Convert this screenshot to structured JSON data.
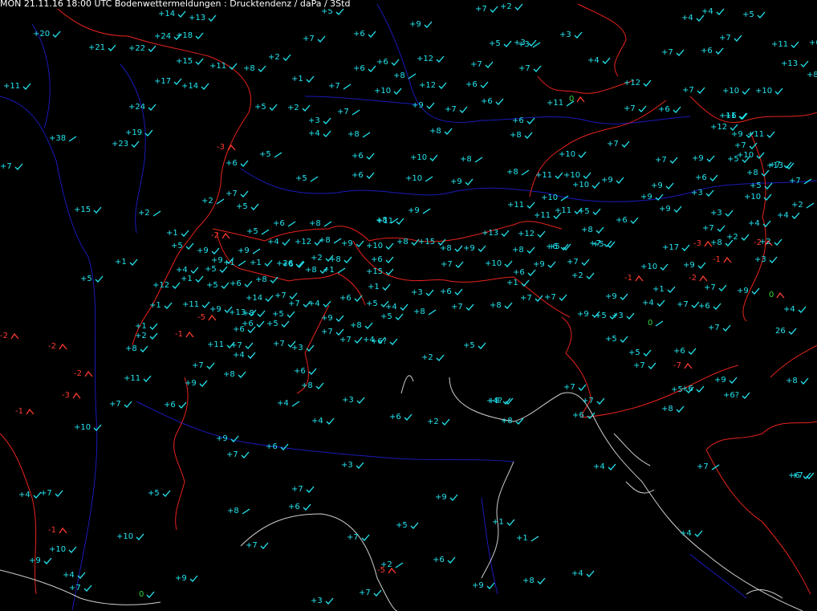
{
  "title": "MON 21.11.16 18:00 UTC  Bodenwettermeldungen :  Drucktendenz / daPa / 3Std",
  "colors": {
    "background": "#000000",
    "rising": "#22e6f0",
    "falling": "#ff3b2f",
    "steady": "#37d43a",
    "border": "#e8231c",
    "river": "#1a1ab8",
    "coast": "#cfcfcf"
  },
  "stations": [
    {
      "v": "+14",
      "s": "check"
    },
    {
      "v": "+13",
      "s": "check"
    },
    {
      "v": "+5",
      "s": "check"
    },
    {
      "v": "+7",
      "s": "check"
    },
    {
      "v": "+2",
      "s": "check"
    },
    {
      "v": "+4",
      "s": "check"
    },
    {
      "v": "+4",
      "s": "check"
    },
    {
      "v": "+5",
      "s": "check"
    },
    {
      "v": "+20",
      "s": "check"
    },
    {
      "v": "+24",
      "s": "check"
    },
    {
      "v": "+18",
      "s": "check"
    },
    {
      "v": "+6",
      "s": "check"
    },
    {
      "v": "+9",
      "s": "check"
    },
    {
      "v": "+7",
      "s": "check"
    },
    {
      "v": "+3",
      "s": "check"
    },
    {
      "v": "+3",
      "s": "check"
    },
    {
      "v": "+7",
      "s": "check"
    },
    {
      "v": "+11",
      "s": "check"
    },
    {
      "v": "+6",
      "s": "check"
    },
    {
      "v": "+21",
      "s": "check"
    },
    {
      "v": "+22",
      "s": "check"
    },
    {
      "v": "+5",
      "s": "check"
    },
    {
      "v": "+3",
      "s": "rise"
    },
    {
      "v": "+7",
      "s": "check"
    },
    {
      "v": "+6",
      "s": "check"
    },
    {
      "v": "+2",
      "s": "check"
    },
    {
      "v": "+15",
      "s": "check"
    },
    {
      "v": "+11",
      "s": "check"
    },
    {
      "v": "+8",
      "s": "check"
    },
    {
      "v": "+6",
      "s": "check"
    },
    {
      "v": "+6",
      "s": "check"
    },
    {
      "v": "+12",
      "s": "check"
    },
    {
      "v": "+7",
      "s": "check"
    },
    {
      "v": "+7",
      "s": "check"
    },
    {
      "v": "+4",
      "s": "check"
    },
    {
      "v": "+13",
      "s": "check"
    },
    {
      "v": "+8",
      "s": "check"
    },
    {
      "v": "+17",
      "s": "check"
    },
    {
      "v": "+14",
      "s": "check"
    },
    {
      "v": "+1",
      "s": "check"
    },
    {
      "v": "+7",
      "s": "rise"
    },
    {
      "v": "+8",
      "s": "rise"
    },
    {
      "v": "+12",
      "s": "check"
    },
    {
      "v": "+6",
      "s": "check"
    },
    {
      "v": "+11",
      "s": "rise"
    },
    {
      "v": "+10",
      "s": "check"
    },
    {
      "v": "+12",
      "s": "check"
    },
    {
      "v": "+7",
      "s": "check"
    },
    {
      "v": "+6",
      "s": "check"
    },
    {
      "v": "+7",
      "s": "check"
    },
    {
      "v": "+10",
      "s": "check"
    },
    {
      "v": "+10",
      "s": "check"
    },
    {
      "v": "+11",
      "s": "check"
    },
    {
      "v": "+24",
      "s": "check"
    },
    {
      "v": "+5",
      "s": "check"
    },
    {
      "v": "+2",
      "s": "check"
    },
    {
      "v": "+7",
      "s": "rise"
    },
    {
      "v": "+9",
      "s": "check"
    },
    {
      "v": "+7",
      "s": "check"
    },
    {
      "v": "+6",
      "s": "check"
    },
    {
      "v": "+11",
      "s": "check"
    },
    {
      "v": "0",
      "s": "fall"
    },
    {
      "v": "+7",
      "s": "check"
    },
    {
      "v": "+6",
      "s": "check"
    },
    {
      "v": "+19",
      "s": "check"
    },
    {
      "v": "+3",
      "s": "check"
    },
    {
      "v": "+4",
      "s": "check"
    },
    {
      "v": "+8",
      "s": "rise"
    },
    {
      "v": "+8",
      "s": "check"
    },
    {
      "v": "+8",
      "s": "check"
    },
    {
      "v": "+6",
      "s": "check"
    },
    {
      "v": "+9",
      "s": "check"
    },
    {
      "v": "+12",
      "s": "check"
    },
    {
      "v": "+11",
      "s": "check"
    },
    {
      "v": "+38",
      "s": "rise"
    },
    {
      "v": "+23",
      "s": "check"
    },
    {
      "v": "-3",
      "s": "fall"
    },
    {
      "v": "+5",
      "s": "rise"
    },
    {
      "v": "+6",
      "s": "check"
    },
    {
      "v": "+10",
      "s": "check"
    },
    {
      "v": "+8",
      "s": "rise"
    },
    {
      "v": "+10",
      "s": "check"
    },
    {
      "v": "+7",
      "s": "check"
    },
    {
      "v": "+9",
      "s": "check"
    },
    {
      "v": "+5",
      "s": "check"
    },
    {
      "v": "+13",
      "s": "check"
    },
    {
      "v": "+7",
      "s": "check"
    },
    {
      "v": "+10",
      "s": "check"
    },
    {
      "v": "+7",
      "s": "check"
    },
    {
      "v": "+6",
      "s": "check"
    },
    {
      "v": "+5",
      "s": "rise"
    },
    {
      "v": "+6",
      "s": "check"
    },
    {
      "v": "+10",
      "s": "rise"
    },
    {
      "v": "+9",
      "s": "check"
    },
    {
      "v": "+8",
      "s": "rise"
    },
    {
      "v": "+11",
      "s": "check"
    },
    {
      "v": "+10",
      "s": "check"
    },
    {
      "v": "+9",
      "s": "check"
    },
    {
      "v": "+6",
      "s": "check"
    },
    {
      "v": "+8",
      "s": "check"
    },
    {
      "v": "+7",
      "s": "check"
    },
    {
      "v": "+7",
      "s": "rise"
    },
    {
      "v": "+7",
      "s": "check"
    },
    {
      "v": "+2",
      "s": "rise"
    },
    {
      "v": "+5",
      "s": "check"
    },
    {
      "v": "+10",
      "s": "rise"
    },
    {
      "v": "+10",
      "s": "check"
    },
    {
      "v": "+9",
      "s": "check"
    },
    {
      "v": "+9",
      "s": "check"
    },
    {
      "v": "+3",
      "s": "check"
    },
    {
      "v": "+10",
      "s": "check"
    },
    {
      "v": "+5",
      "s": "check"
    },
    {
      "v": "+2",
      "s": "rise"
    },
    {
      "v": "+15",
      "s": "check"
    },
    {
      "v": "+2",
      "s": "rise"
    },
    {
      "v": "+8",
      "s": "rise"
    },
    {
      "v": "+9",
      "s": "rise"
    },
    {
      "v": "+11",
      "s": "check"
    },
    {
      "v": "+11",
      "s": "check"
    },
    {
      "v": "+11",
      "s": "check"
    },
    {
      "v": "+5",
      "s": "check"
    },
    {
      "v": "+6",
      "s": "check"
    },
    {
      "v": "+9",
      "s": "check"
    },
    {
      "v": "+3",
      "s": "check"
    },
    {
      "v": "+4",
      "s": "check"
    },
    {
      "v": "+1",
      "s": "check"
    },
    {
      "v": "-2",
      "s": "fall"
    },
    {
      "v": "+5",
      "s": "rise"
    },
    {
      "v": "+6",
      "s": "rise"
    },
    {
      "v": "+8",
      "s": "rise"
    },
    {
      "v": "+8",
      "s": "check"
    },
    {
      "v": "+13",
      "s": "check"
    },
    {
      "v": "+12",
      "s": "check"
    },
    {
      "v": "+7",
      "s": "check"
    },
    {
      "v": "+8",
      "s": "check"
    },
    {
      "v": "+6",
      "s": "check"
    },
    {
      "v": "+7",
      "s": "check"
    },
    {
      "v": "-3",
      "s": "fall"
    },
    {
      "v": "+2",
      "s": "check"
    },
    {
      "v": "+4",
      "s": "check"
    },
    {
      "v": "+5",
      "s": "check"
    },
    {
      "v": "+4",
      "s": "check"
    },
    {
      "v": "+8",
      "s": "rise"
    },
    {
      "v": "+9",
      "s": "check"
    },
    {
      "v": "+9",
      "s": "rise"
    },
    {
      "v": "+11",
      "s": "check"
    },
    {
      "v": "+8",
      "s": "check"
    },
    {
      "v": "+15",
      "s": "check"
    },
    {
      "v": "+17",
      "s": "check"
    },
    {
      "v": "+8",
      "s": "check"
    },
    {
      "v": "+5",
      "s": "check"
    },
    {
      "v": "+5",
      "s": "check"
    },
    {
      "v": "-2",
      "s": "fall"
    },
    {
      "v": "+2",
      "s": "check"
    },
    {
      "v": "+9",
      "s": "check"
    },
    {
      "v": "+12",
      "s": "check"
    },
    {
      "v": "+2",
      "s": "check"
    },
    {
      "v": "+8",
      "s": "check"
    },
    {
      "v": "+10",
      "s": "check"
    },
    {
      "v": "+6",
      "s": "check"
    },
    {
      "v": "+8",
      "s": "check"
    },
    {
      "v": "+9",
      "s": "check"
    },
    {
      "v": "-1",
      "s": "fall"
    },
    {
      "v": "+3",
      "s": "check"
    },
    {
      "v": "+5",
      "s": "check"
    },
    {
      "v": "+1",
      "s": "rise"
    },
    {
      "v": "+1",
      "s": "check"
    },
    {
      "v": "+26",
      "s": "check"
    },
    {
      "v": "+15",
      "s": "check"
    },
    {
      "v": "+7",
      "s": "check"
    },
    {
      "v": "+10",
      "s": "check"
    },
    {
      "v": "+6",
      "s": "check"
    },
    {
      "v": "+9",
      "s": "check"
    },
    {
      "v": "+7",
      "s": "check"
    },
    {
      "v": "+10",
      "s": "check"
    },
    {
      "v": "+9",
      "s": "check"
    },
    {
      "v": "-2",
      "s": "fall"
    },
    {
      "v": "+7",
      "s": "check"
    },
    {
      "v": "+12",
      "s": "check"
    },
    {
      "v": "+1",
      "s": "check"
    },
    {
      "v": "+5",
      "s": "check"
    },
    {
      "v": "+6",
      "s": "check"
    },
    {
      "v": "+8",
      "s": "check"
    },
    {
      "v": "+8",
      "s": "check"
    },
    {
      "v": "+1",
      "s": "rise"
    },
    {
      "v": "+1",
      "s": "check"
    },
    {
      "v": "+3",
      "s": "check"
    },
    {
      "v": "+1",
      "s": "check"
    },
    {
      "v": "+2",
      "s": "check"
    },
    {
      "v": "-1",
      "s": "fall"
    },
    {
      "v": "+1",
      "s": "check"
    },
    {
      "v": "0",
      "s": "fall"
    },
    {
      "v": "+5",
      "s": "check"
    },
    {
      "v": "+1",
      "s": "check"
    },
    {
      "v": "+4",
      "s": "check"
    },
    {
      "v": "+9",
      "s": "check"
    },
    {
      "v": "+6",
      "s": "check"
    },
    {
      "v": "+6",
      "s": "check"
    },
    {
      "v": "+8",
      "s": "check"
    },
    {
      "v": "+9",
      "s": "check"
    },
    {
      "v": "+6",
      "s": "check"
    },
    {
      "v": "+4",
      "s": "check"
    },
    {
      "v": "+14",
      "s": "check"
    },
    {
      "v": "+7",
      "s": "check"
    },
    {
      "v": "+4",
      "s": "check"
    },
    {
      "v": "+6",
      "s": "check"
    },
    {
      "v": "+5",
      "s": "check"
    },
    {
      "v": "+7",
      "s": "check"
    },
    {
      "v": "+7",
      "s": "check"
    },
    {
      "v": "+9",
      "s": "check"
    },
    {
      "v": "+7",
      "s": "check"
    },
    {
      "v": "+1",
      "s": "check"
    },
    {
      "v": "+11",
      "s": "check"
    },
    {
      "v": "+9",
      "s": "check"
    },
    {
      "v": "+8",
      "s": "check"
    },
    {
      "v": "+7",
      "s": "check"
    },
    {
      "v": "+4",
      "s": "check"
    },
    {
      "v": "+8",
      "s": "rise"
    },
    {
      "v": "+9",
      "s": "check"
    },
    {
      "v": "+4",
      "s": "check"
    },
    {
      "v": "+1",
      "s": "check"
    },
    {
      "v": "-5",
      "s": "fall"
    },
    {
      "v": "+13",
      "s": "check"
    },
    {
      "v": "+5",
      "s": "check"
    },
    {
      "v": "+9",
      "s": "check"
    },
    {
      "v": "+5",
      "s": "check"
    },
    {
      "v": "+7",
      "s": "check"
    },
    {
      "v": "+5",
      "s": "check"
    },
    {
      "v": "+3",
      "s": "check"
    },
    {
      "v": "+7",
      "s": "check"
    },
    {
      "v": "26",
      "s": "check"
    },
    {
      "v": "-2",
      "s": "fall"
    },
    {
      "v": "+2",
      "s": "check"
    },
    {
      "v": "-1",
      "s": "fall"
    },
    {
      "v": "+6",
      "s": "check"
    },
    {
      "v": "+6",
      "s": "check"
    },
    {
      "v": "+5",
      "s": "check"
    },
    {
      "v": "+7",
      "s": "check"
    },
    {
      "v": "+8",
      "s": "check"
    },
    {
      "v": "+4",
      "s": "check"
    },
    {
      "v": "+7",
      "s": "check"
    },
    {
      "v": "+6?",
      "s": "check"
    },
    {
      "v": "+5",
      "s": "check"
    },
    {
      "v": "0",
      "s": "rise"
    },
    {
      "v": "-2",
      "s": "fall"
    },
    {
      "v": "+8",
      "s": "check"
    },
    {
      "v": "+11",
      "s": "check"
    },
    {
      "v": "+7",
      "s": "check"
    },
    {
      "v": "+4",
      "s": "check"
    },
    {
      "v": "+7",
      "s": "check"
    },
    {
      "v": "+3",
      "s": "check"
    },
    {
      "v": "+2",
      "s": "check"
    },
    {
      "v": "+5",
      "s": "check"
    },
    {
      "v": "+5",
      "s": "check"
    },
    {
      "v": "+6",
      "s": "check"
    },
    {
      "v": "+7",
      "s": "check"
    },
    {
      "v": "+7",
      "s": "check"
    },
    {
      "v": "+8",
      "s": "check"
    },
    {
      "v": "+6",
      "s": "check"
    },
    {
      "v": "+4?",
      "s": "check"
    },
    {
      "v": "-7",
      "s": "fall"
    },
    {
      "v": "-2",
      "s": "fall"
    },
    {
      "v": "+11",
      "s": "check"
    },
    {
      "v": "+9",
      "s": "check"
    },
    {
      "v": "+8",
      "s": "check"
    },
    {
      "v": "+7",
      "s": "check"
    },
    {
      "v": "+6",
      "s": "check"
    },
    {
      "v": "+9",
      "s": "check"
    },
    {
      "v": "+8",
      "s": "check"
    },
    {
      "v": "+3",
      "s": "check"
    },
    {
      "v": "+2",
      "s": "check"
    },
    {
      "v": "+4",
      "s": "rise"
    },
    {
      "v": "-3",
      "s": "fall"
    },
    {
      "v": "+7",
      "s": "check"
    },
    {
      "v": "+6",
      "s": "check"
    },
    {
      "v": "+8",
      "s": "check"
    },
    {
      "v": "+7",
      "s": "check"
    },
    {
      "v": "+5",
      "s": "check"
    },
    {
      "v": "+6?",
      "s": "check"
    },
    {
      "v": "+8",
      "s": "check"
    },
    {
      "v": "-1",
      "s": "fall"
    },
    {
      "v": "+10",
      "s": "check"
    },
    {
      "v": "+4",
      "s": "check"
    },
    {
      "v": "+6",
      "s": "check"
    },
    {
      "v": "+8",
      "s": "check"
    },
    {
      "v": "+6",
      "s": "check"
    },
    {
      "v": "+9",
      "s": "check"
    },
    {
      "v": "+7",
      "s": "check"
    },
    {
      "v": "+6",
      "s": "check"
    },
    {
      "v": "+3",
      "s": "check"
    },
    {
      "v": "+7",
      "s": "rise"
    },
    {
      "v": "+4",
      "s": "check"
    },
    {
      "v": "+4",
      "s": "check"
    },
    {
      "v": "+7",
      "s": "check"
    },
    {
      "v": "+5",
      "s": "check"
    },
    {
      "v": "+7",
      "s": "check"
    },
    {
      "v": "+9",
      "s": "check"
    },
    {
      "v": "+6",
      "s": "check"
    },
    {
      "v": "+8",
      "s": "rise"
    },
    {
      "v": "+2",
      "s": "rise"
    },
    {
      "v": "+7",
      "s": "check"
    },
    {
      "v": "+6",
      "s": "check"
    },
    {
      "v": "+4",
      "s": "check"
    },
    {
      "v": "+1",
      "s": "check"
    },
    {
      "v": "+1",
      "s": "rise"
    },
    {
      "v": "+5",
      "s": "check"
    },
    {
      "v": "+7",
      "s": "check"
    },
    {
      "v": "+7",
      "s": "check"
    },
    {
      "v": "+10",
      "s": "check"
    },
    {
      "v": "-1",
      "s": "fall"
    },
    {
      "v": "+10",
      "s": "check"
    },
    {
      "v": "+9",
      "s": "check"
    },
    {
      "v": "+6",
      "s": "check"
    },
    {
      "v": "+4",
      "s": "check"
    },
    {
      "v": "+4",
      "s": "check"
    },
    {
      "v": "+7",
      "s": "check"
    },
    {
      "v": "+9",
      "s": "check"
    },
    {
      "v": "0",
      "s": "check"
    },
    {
      "v": "-5",
      "s": "fall"
    },
    {
      "v": "+9",
      "s": "check"
    },
    {
      "v": "+8",
      "s": "check"
    },
    {
      "v": "+3",
      "s": "check"
    },
    {
      "v": "+7",
      "s": "check"
    }
  ]
}
